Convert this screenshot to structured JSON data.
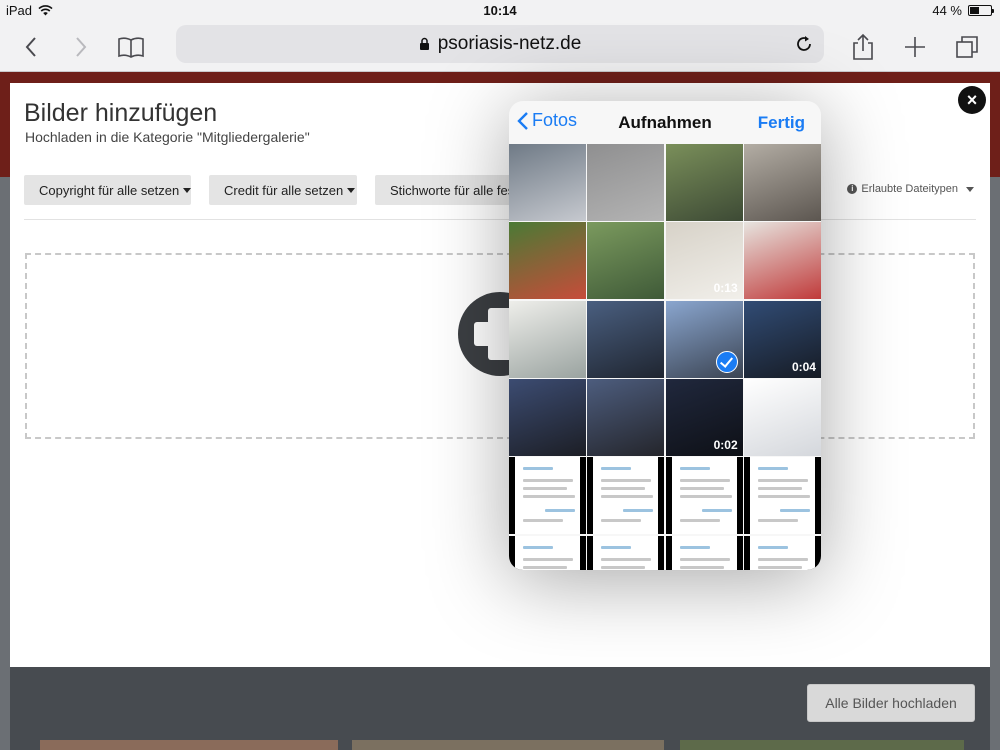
{
  "status": {
    "device": "iPad",
    "time": "10:14",
    "battery": "44 %",
    "battery_level": 0.44
  },
  "browser": {
    "url": "psoriasis-netz.de"
  },
  "modal": {
    "title": "Bilder hinzufügen",
    "subtitle": "Hochladen in die Kategorie \"Mitgliedergalerie\"",
    "copyright_btn": "Copyright für alle setzen",
    "credit_btn": "Credit für alle setzen",
    "tags_btn": "Stichworte für alle festlegen",
    "file_types": "Erlaubte Dateitypen",
    "close": "×",
    "upload_all": "Alle Bilder hochladen"
  },
  "picker": {
    "back": "Fotos",
    "title": "Aufnahmen",
    "done": "Fertig",
    "tiles": [
      {
        "colors": [
          "#6f7a86",
          "#c6c9cf"
        ]
      },
      {
        "colors": [
          "#8f8f90",
          "#b4b4b4"
        ]
      },
      {
        "colors": [
          "#7a8f5a",
          "#3d4a35"
        ]
      },
      {
        "colors": [
          "#b3ada4",
          "#5c5650"
        ]
      },
      {
        "colors": [
          "#4a7a35",
          "#c74c3a"
        ]
      },
      {
        "colors": [
          "#7b9a5e",
          "#3f5a38"
        ]
      },
      {
        "colors": [
          "#d7d2c8",
          "#f1efea"
        ],
        "duration": "0:13"
      },
      {
        "colors": [
          "#e7e4df",
          "#c03a3a"
        ]
      },
      {
        "colors": [
          "#eeeeea",
          "#9aa3a0"
        ]
      },
      {
        "colors": [
          "#4a5f80",
          "#1f2530"
        ]
      },
      {
        "colors": [
          "#8aa6cf",
          "#3b4453"
        ],
        "selected": true
      },
      {
        "colors": [
          "#314c75",
          "#161b24"
        ],
        "duration": "0:04"
      },
      {
        "colors": [
          "#3c4c72",
          "#1c1e25"
        ]
      },
      {
        "colors": [
          "#4d5d7e",
          "#24252b"
        ]
      },
      {
        "colors": [
          "#20283d",
          "#0e1016"
        ],
        "duration": "0:02"
      },
      {
        "colors": [
          "#ffffff",
          "#d4d7dc"
        ]
      },
      {
        "colors": [
          "#ffffff",
          "#ffffff"
        ],
        "phone": true
      },
      {
        "colors": [
          "#ffffff",
          "#ffffff"
        ],
        "phone": true
      },
      {
        "colors": [
          "#ffffff",
          "#ffffff"
        ],
        "phone": true
      },
      {
        "colors": [
          "#ffffff",
          "#ffffff"
        ],
        "phone": true
      },
      {
        "colors": [
          "#ffffff",
          "#ffffff"
        ],
        "phone": true
      },
      {
        "colors": [
          "#ffffff",
          "#ffffff"
        ],
        "phone": true
      },
      {
        "colors": [
          "#ffffff",
          "#ffffff"
        ],
        "phone": true
      },
      {
        "colors": [
          "#ffffff",
          "#ffffff"
        ],
        "phone": true
      }
    ]
  }
}
